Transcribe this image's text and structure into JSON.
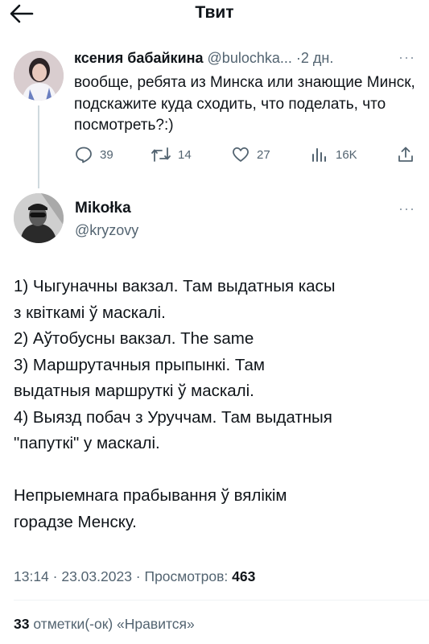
{
  "header": {
    "title": "Твит",
    "back_icon": "arrow-left-icon"
  },
  "reply_to": {
    "author_name": "ксения бабайкина",
    "handle": "@bulochka...",
    "time": "·2 дн.",
    "more": "···",
    "text": "вообще, ребята из Минска или знающие Минск, подскажите куда сходить, что поделать, что посмотреть?:)",
    "stats": {
      "replies": "39",
      "retweets": "14",
      "likes": "27",
      "views": "16K"
    }
  },
  "tweet": {
    "author_name": "Mikołka",
    "handle": "@kryzovy",
    "more": "···",
    "lines": [
      "1) Чыгуначны вакзал. Там выдатныя касы",
      "з квіткамі ў маскалі.",
      "2) Аўтобусны вакзал. The same",
      "3) Маршрутачныя прыпынкі. Там",
      "выдатныя маршруткі ў маскалі.",
      "4) Выязд побач з Уруччам. Там выдатныя",
      "\"папуткі\" у маскалі.",
      "",
      "Непрыемнага прабывання ў вялікім",
      "горадзе Менску."
    ],
    "time": "13:14 · 23.03.2023 · ",
    "views_label": "Просмотров: ",
    "views_count": "463",
    "likes_count": "33",
    "likes_label": " отметки(-ок) «Нравится»"
  },
  "colors": {
    "text": "#0f1419",
    "muted": "#536471",
    "divider": "#eff3f4"
  }
}
